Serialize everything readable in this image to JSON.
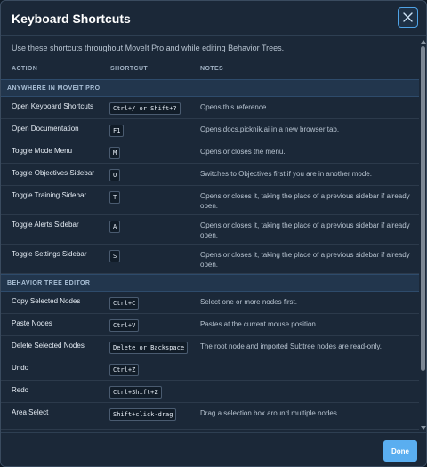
{
  "dialog": {
    "title": "Keyboard Shortcuts",
    "close_icon": "close-icon",
    "intro": "Use these shortcuts throughout MoveIt Pro and while editing Behavior Trees.",
    "columns": {
      "action": "ACTION",
      "shortcut": "SHORTCUT",
      "notes": "NOTES"
    },
    "sections": [
      {
        "title": "ANYWHERE IN MOVEIT PRO",
        "rows": [
          {
            "action": "Open Keyboard Shortcuts",
            "shortcut": "Ctrl+/ or Shift+?",
            "note": "Opens this reference."
          },
          {
            "action": "Open Documentation",
            "shortcut": "F1",
            "note": "Opens docs.picknik.ai in a new browser tab."
          },
          {
            "action": "Toggle Mode Menu",
            "shortcut": "M",
            "note": "Opens or closes the menu."
          },
          {
            "action": "Toggle Objectives Sidebar",
            "shortcut": "O",
            "note": "Switches to Objectives first if you are in another mode."
          },
          {
            "action": "Toggle Training Sidebar",
            "shortcut": "T",
            "note": "Opens or closes it, taking the place of a previous sidebar if already open."
          },
          {
            "action": "Toggle Alerts Sidebar",
            "shortcut": "A",
            "note": "Opens or closes it, taking the place of a previous sidebar if already open."
          },
          {
            "action": "Toggle Settings Sidebar",
            "shortcut": "S",
            "note": "Opens or closes it, taking the place of a previous sidebar if already open."
          }
        ]
      },
      {
        "title": "BEHAVIOR TREE EDITOR",
        "rows": [
          {
            "action": "Copy Selected Nodes",
            "shortcut": "Ctrl+C",
            "note": "Select one or more nodes first."
          },
          {
            "action": "Paste Nodes",
            "shortcut": "Ctrl+V",
            "note": "Pastes at the current mouse position."
          },
          {
            "action": "Delete Selected Nodes",
            "shortcut": "Delete or Backspace",
            "note": "The root node and imported Subtree nodes are read-only."
          },
          {
            "action": "Undo",
            "shortcut": "Ctrl+Z",
            "note": ""
          },
          {
            "action": "Redo",
            "shortcut": "Ctrl+Shift+Z",
            "note": ""
          },
          {
            "action": "Area Select",
            "shortcut": "Shift+click-drag",
            "note": "Drag a selection box around multiple nodes."
          }
        ]
      }
    ],
    "done_label": "Done",
    "colors": {
      "accent": "#5aaef0",
      "background": "#1b2838",
      "section": "#22364d"
    }
  }
}
